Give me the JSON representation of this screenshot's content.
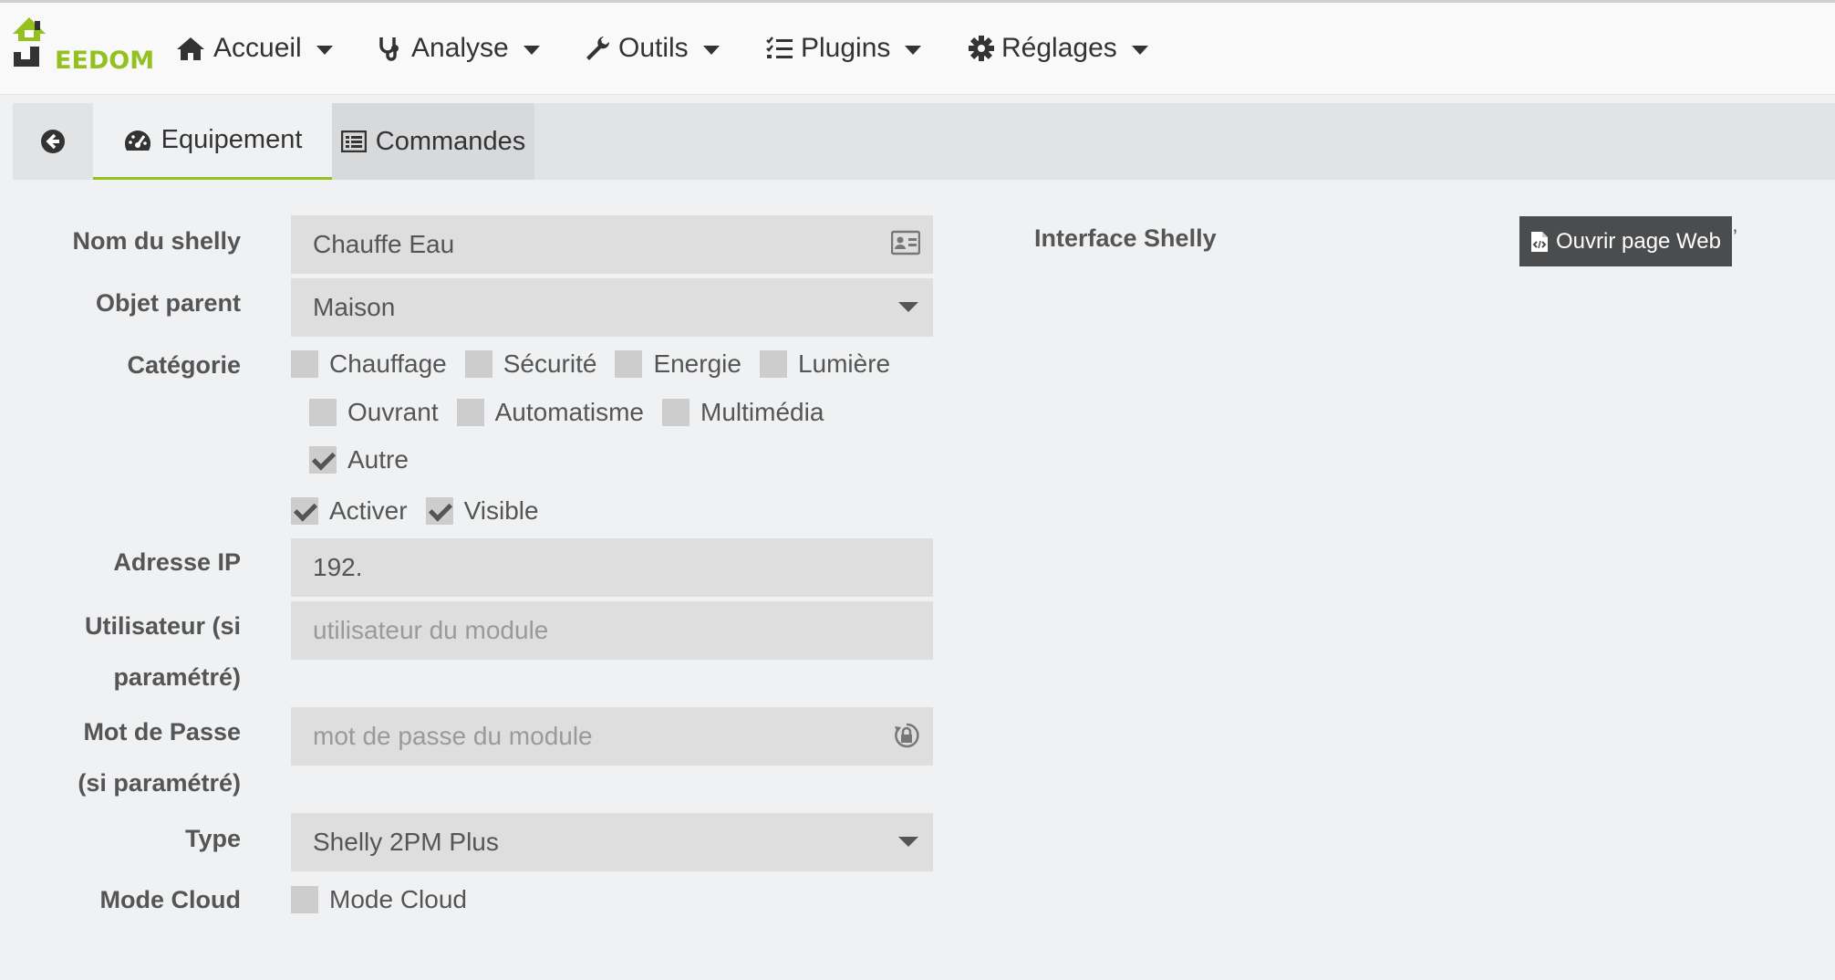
{
  "brand": {
    "logo_text": "EEDOM",
    "accent": "#94c11f"
  },
  "nav": [
    {
      "label": "Accueil",
      "icon": "home-icon"
    },
    {
      "label": "Analyse",
      "icon": "stethoscope-icon"
    },
    {
      "label": "Outils",
      "icon": "wrench-icon"
    },
    {
      "label": "Plugins",
      "icon": "tasks-icon"
    },
    {
      "label": "Réglages",
      "icon": "gear-icon"
    }
  ],
  "tabs": {
    "back_icon": "arrow-circle-left-icon",
    "equipement": "Equipement",
    "commandes": "Commandes"
  },
  "form": {
    "name_label": "Nom du shelly",
    "name_value": "Chauffe Eau",
    "parent_label": "Objet parent",
    "parent_value": "Maison",
    "category_label": "Catégorie",
    "categories": [
      {
        "label": "Chauffage",
        "checked": false
      },
      {
        "label": "Sécurité",
        "checked": false
      },
      {
        "label": "Energie",
        "checked": false
      },
      {
        "label": "Lumière",
        "checked": false
      },
      {
        "label": "Ouvrant",
        "checked": false
      },
      {
        "label": "Automatisme",
        "checked": false
      },
      {
        "label": "Multimédia",
        "checked": false
      },
      {
        "label": "Autre",
        "checked": true
      }
    ],
    "enable_label": "Activer",
    "enable_checked": true,
    "visible_label": "Visible",
    "visible_checked": true,
    "ip_label": "Adresse IP",
    "ip_value": "192.",
    "user_label_1": "Utilisateur (si",
    "user_label_2": "paramétré)",
    "user_placeholder": "utilisateur du module",
    "pass_label_1": "Mot de Passe",
    "pass_label_2": "(si paramétré)",
    "pass_placeholder": "mot de passe du module",
    "type_label": "Type",
    "type_value": "Shelly 2PM Plus",
    "cloud_label": "Mode Cloud",
    "cloud_checkbox_label": "Mode Cloud",
    "cloud_checked": false
  },
  "side": {
    "interface_label": "Interface Shelly",
    "open_web_button": "Ouvrir page Web",
    "trailing_mark": "’"
  }
}
